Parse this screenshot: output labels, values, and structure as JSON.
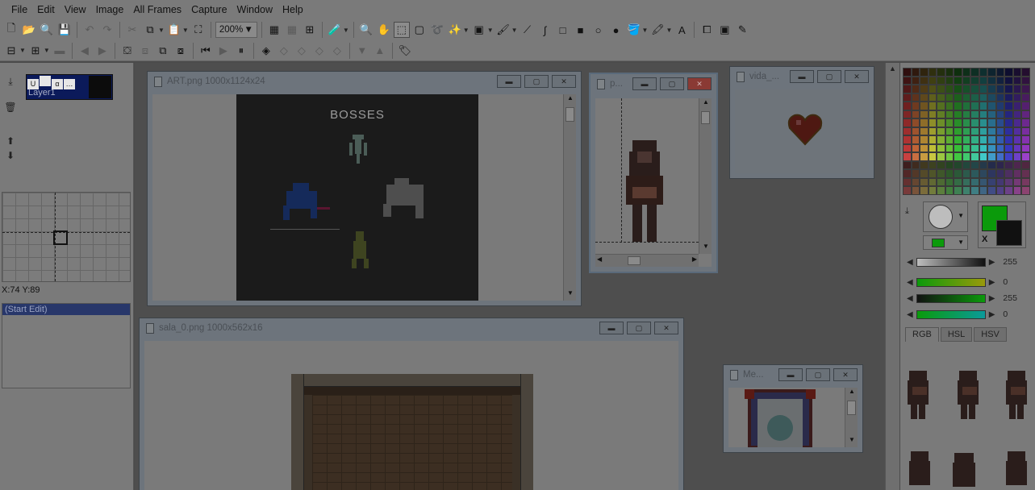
{
  "menu": [
    "File",
    "Edit",
    "View",
    "Image",
    "All Frames",
    "Capture",
    "Window",
    "Help"
  ],
  "toolbar": {
    "zoom": "200%"
  },
  "layers": {
    "layer_name": "Layer1",
    "alpha_label": "α"
  },
  "navigator": {
    "coords": "X:74 Y:89"
  },
  "history": {
    "items": [
      "(Start Edit)"
    ]
  },
  "windows": {
    "art": {
      "title": "ART.png 1000x1124x24",
      "canvas_text": "BOSSES"
    },
    "p": {
      "title": "p..."
    },
    "vida": {
      "title": "vida_..."
    },
    "sala": {
      "title": "sala_0.png 1000x562x16"
    },
    "me": {
      "title": "Me..."
    }
  },
  "colors": {
    "primary": "#0b9a0b",
    "secondary": "#111111",
    "slider_values": [
      "255",
      "0",
      "255",
      "0"
    ],
    "swap_label": "X",
    "tabs": [
      "RGB",
      "HSL",
      "HSV"
    ]
  }
}
